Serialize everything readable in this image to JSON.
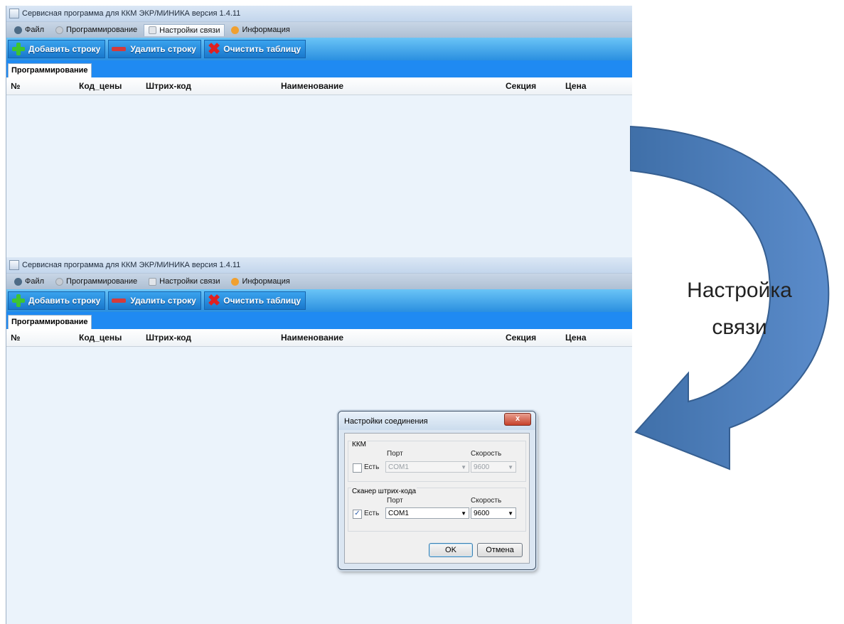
{
  "window": {
    "title": "Сервисная программа для ККМ ЭКР/МИНИКА версия 1.4.11",
    "menu": [
      "Файл",
      "Программирование",
      "Настройки связи",
      "Информация"
    ],
    "toolbar": {
      "add_row": "Добавить строку",
      "delete_row": "Удалить строку",
      "clear_table": "Очистить таблицу"
    },
    "tab": "Программирование",
    "columns": [
      "№",
      "Код_цены",
      "Штрих-код",
      "Наименование",
      "Секция",
      "Цена"
    ]
  },
  "dialog": {
    "title": "Настройки соединения",
    "close": "x",
    "kkm": {
      "group": "ККМ",
      "port_label": "Порт",
      "speed_label": "Скорость",
      "checkbox_label": "Есть",
      "checked": false,
      "port": "COM1",
      "speed": "9600"
    },
    "scanner": {
      "group": "Сканер штрих-кода",
      "port_label": "Порт",
      "speed_label": "Скорость",
      "checkbox_label": "Есть",
      "checked": true,
      "port": "COM1",
      "speed": "9600"
    },
    "ok": "OK",
    "cancel": "Отмена"
  },
  "annotation": {
    "line1": "Настройка",
    "line2": "связи",
    "arrow_color": "#4f81bd"
  }
}
